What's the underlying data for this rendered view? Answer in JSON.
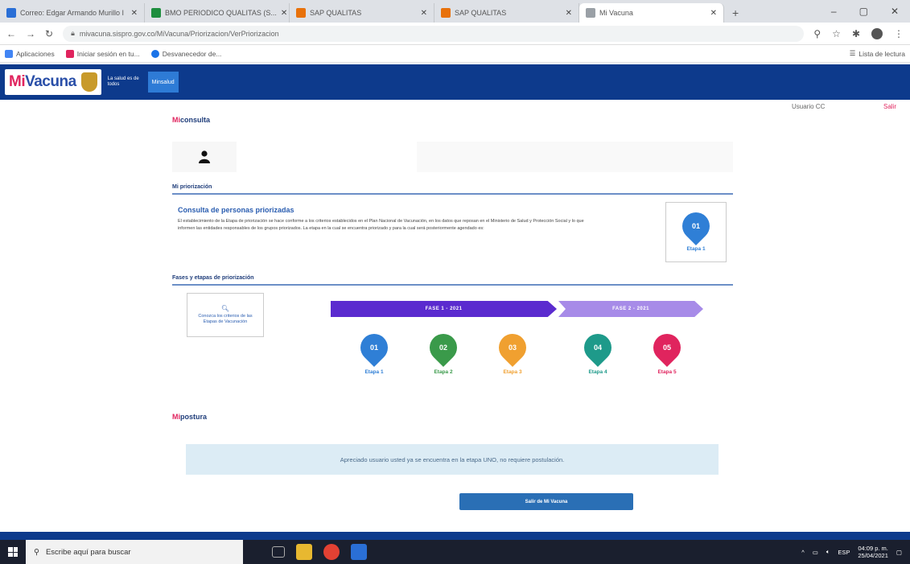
{
  "browser": {
    "tabs": [
      {
        "title": "Correo: Edgar Armando Murillo I",
        "color": "#2a6fd6"
      },
      {
        "title": "BMO PERIODICO QUALITAS (S...",
        "color": "#1e8e3e"
      },
      {
        "title": "SAP QUALITAS",
        "color": "#e8710a"
      },
      {
        "title": "SAP QUALITAS",
        "color": "#e8710a"
      },
      {
        "title": "Mi Vacuna",
        "color": "#9aa0a6"
      }
    ],
    "url": "mivacuna.sispro.gov.co/MiVacuna/Priorizacion/VerPriorizacion",
    "bookmarks": [
      {
        "label": "Aplicaciones",
        "color": "#4285f4"
      },
      {
        "label": "Iniciar sesión en tu...",
        "color": "#e0245e"
      },
      {
        "label": "Desvanecedor de...",
        "color": "#1a73e8"
      }
    ],
    "reading_list": "Lista de lectura"
  },
  "header": {
    "logo_prefix": "Mi",
    "logo_suffix": "Vacuna",
    "salud_text": "La salud es de todos",
    "nav_item": "Minsalud"
  },
  "user": {
    "name": "Usuario CC",
    "logout": "Salir"
  },
  "consulta": {
    "prefix": "Mi",
    "title": "consulta"
  },
  "priorizacion": {
    "subhead": "Mi priorización",
    "title": "Consulta de personas priorizadas",
    "description": "El establecimiento de la Etapa de priorización se hace conforme a los criterios establecidos en el Plan Nacional de Vacunación, en los datos que reposan en el Ministerio de Salud y Protección Social y lo que informen las entidades responsables de los grupos priorizados. La etapa en la cual se encuentra priorizado y para la cual será posteriormente agendado es:",
    "current_stage": {
      "number": "01",
      "label": "Etapa 1",
      "color": "#2f7fd6"
    }
  },
  "fases": {
    "subhead": "Fases y etapas de priorización",
    "criteria_button": "Conozca los criterios de las Etapas de Vacunación",
    "phase1": "FASE 1 - 2021",
    "phase2": "FASE 2 - 2021",
    "stages": [
      {
        "number": "01",
        "label": "Etapa 1",
        "color": "#2f7fd6"
      },
      {
        "number": "02",
        "label": "Etapa 2",
        "color": "#3a9a4a"
      },
      {
        "number": "03",
        "label": "Etapa 3",
        "color": "#f0a030"
      },
      {
        "number": "04",
        "label": "Etapa 4",
        "color": "#1e9a8a"
      },
      {
        "number": "05",
        "label": "Etapa 5",
        "color": "#e0245e"
      }
    ]
  },
  "postura": {
    "prefix": "Mi",
    "title": "postura"
  },
  "info_message": "Apreciado usuario usted ya se encuentra en la etapa UNO, no requiere postulación.",
  "exit_button": "Salir de Mi Vacuna",
  "taskbar": {
    "search_placeholder": "Escribe aquí para buscar",
    "time": "04:09 p. m.",
    "date": "25/04/2021",
    "lang": "ESP"
  }
}
